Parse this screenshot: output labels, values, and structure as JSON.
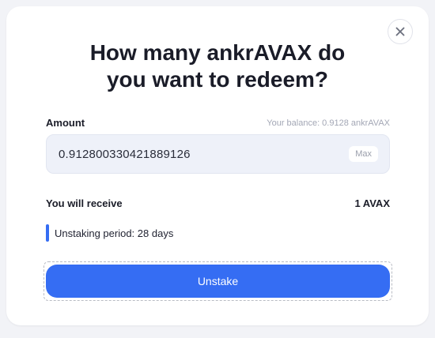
{
  "modal": {
    "title_line1": "How many ankrAVAX do",
    "title_line2": "you want to redeem?",
    "close_icon": "close-icon"
  },
  "amount": {
    "label": "Amount",
    "balance_text": "Your balance: 0.9128 ankrAVAX",
    "value": "0.912800330421889126",
    "max_label": "Max"
  },
  "receive": {
    "label": "You will receive",
    "value": "1 AVAX"
  },
  "notice": {
    "text": "Unstaking period: 28 days"
  },
  "actions": {
    "unstake_label": "Unstake"
  },
  "colors": {
    "accent": "#356df3",
    "page_background": "#f2f3f7",
    "field_background": "#eef1f9"
  }
}
